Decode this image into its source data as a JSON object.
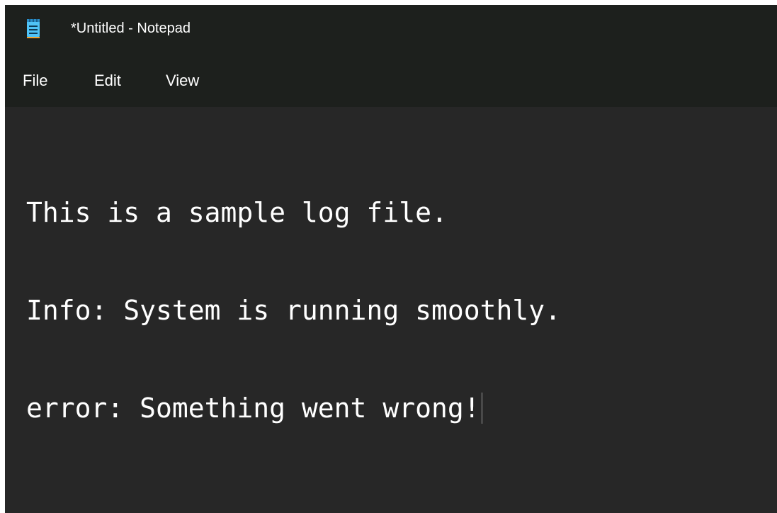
{
  "window": {
    "title": "*Untitled - Notepad",
    "icon": "notepad-icon"
  },
  "menu": {
    "items": [
      {
        "label": "File"
      },
      {
        "label": "Edit"
      },
      {
        "label": "View"
      }
    ]
  },
  "editor": {
    "lines": [
      "This is a sample log file.",
      "Info: System is running smoothly.",
      "error: Something went wrong!"
    ]
  },
  "colors": {
    "chrome": "#1d201d",
    "editor_bg": "#272727",
    "text": "#ffffff",
    "icon_accent": "#4fc3f7"
  }
}
